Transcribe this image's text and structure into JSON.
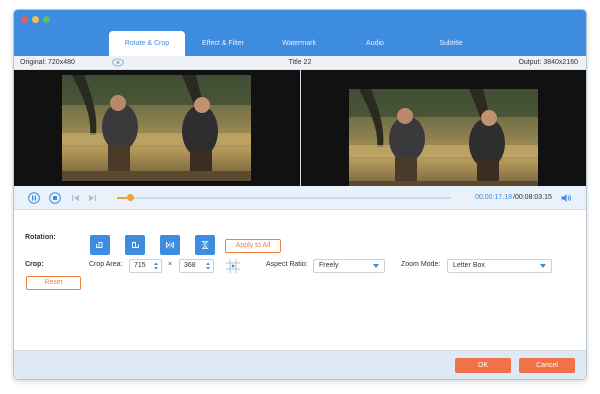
{
  "tabs": [
    {
      "label": "Rotate & Crop",
      "active": true
    },
    {
      "label": "Effect & Filter",
      "active": false
    },
    {
      "label": "Watermark",
      "active": false
    },
    {
      "label": "Audio",
      "active": false
    },
    {
      "label": "Subtitle",
      "active": false
    }
  ],
  "info": {
    "original": "Original: 720x480",
    "title": "Title 22",
    "output": "Output: 3840x2160"
  },
  "playback": {
    "current_time": "00:00:17.18",
    "total_time": "/00:08:03.15",
    "progress_fraction": 0.04
  },
  "rotation": {
    "label": "Rotation:",
    "apply_all": "Apply to All"
  },
  "crop": {
    "label": "Crop:",
    "area_label": "Crop Area:",
    "width": "715",
    "times": "×",
    "height": "368",
    "aspect_label": "Aspect Ratio:",
    "aspect_value": "Freely",
    "zoom_label": "Zoom Mode:",
    "zoom_value": "Letter Box",
    "reset": "Reset"
  },
  "footer": {
    "ok": "OK",
    "cancel": "Cancel"
  },
  "colors": {
    "accent": "#3d8ce0",
    "orange": "#f0714a",
    "progress": "#f0a030"
  }
}
